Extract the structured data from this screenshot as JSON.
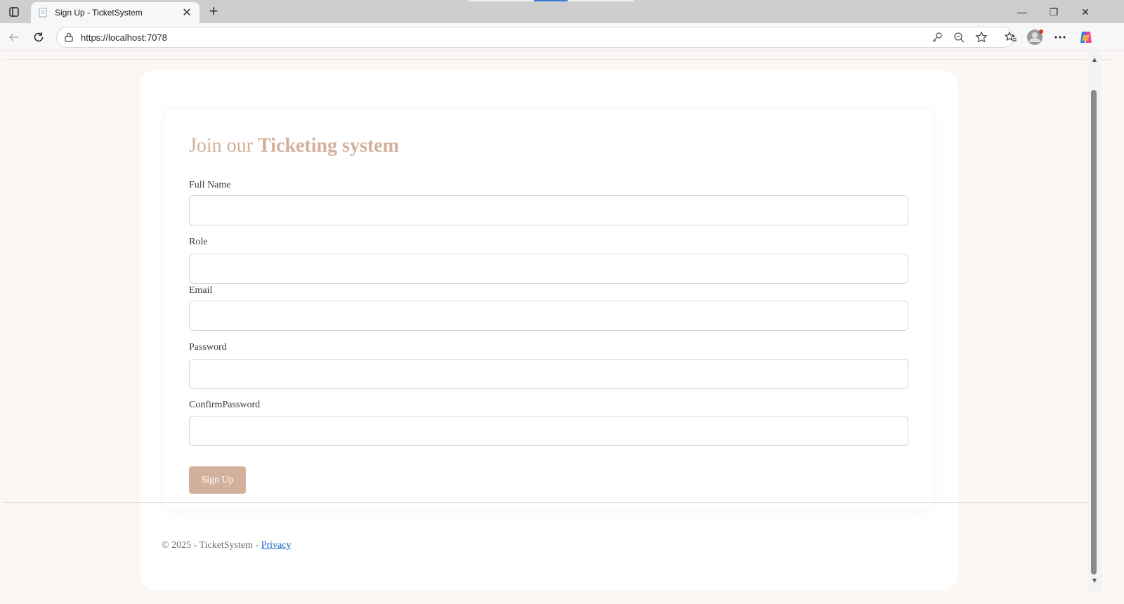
{
  "browser": {
    "tab_title": "Sign Up - TicketSystem",
    "tab_close": "✕",
    "new_tab": "+",
    "url": "https://localhost:7078",
    "icons": [
      "tab-actions-icon",
      "page-favicon",
      "back-icon",
      "refresh-icon",
      "lock-icon",
      "key-icon",
      "zoom-out-icon",
      "favorite-star-icon",
      "favorites-icon",
      "profile-icon",
      "more-icon",
      "copilot-icon"
    ],
    "window_controls": {
      "minimize": "—",
      "restore": "❐",
      "close": "✕"
    }
  },
  "page": {
    "heading_light": "Join our ",
    "heading_bold": "Ticketing system",
    "fields": [
      {
        "label": "Full Name",
        "value": ""
      },
      {
        "label": "Role",
        "value": ""
      },
      {
        "label": "Email",
        "value": ""
      },
      {
        "label": "Password",
        "value": ""
      },
      {
        "label": "ConfirmPassword",
        "value": ""
      }
    ],
    "submit_label": "Sign Up",
    "accent_color": "#d3b09b"
  },
  "footer": {
    "copyright": "© 2025 - TicketSystem - ",
    "privacy_link": "Privacy"
  }
}
